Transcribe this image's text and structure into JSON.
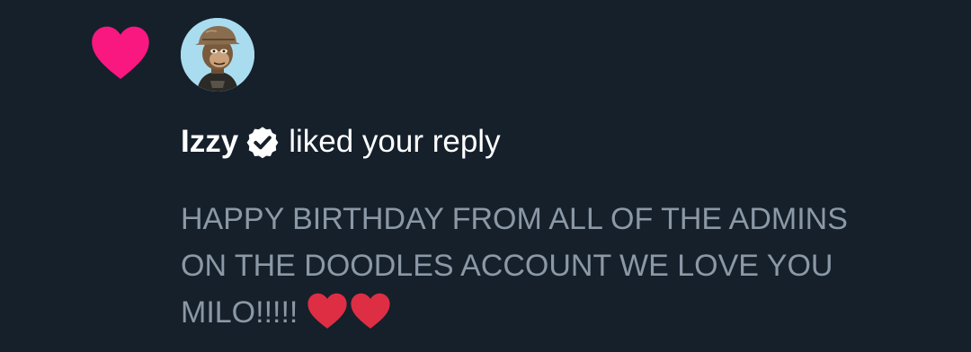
{
  "notification": {
    "type_icon": "heart-icon",
    "avatar_icon": "ape-avatar-icon",
    "username": "Izzy",
    "verified_icon": "verified-badge-icon",
    "action": "liked your reply",
    "reply_lines": [
      "HAPPY BIRTHDAY FROM ALL OF THE ADMINS",
      "ON THE DOODLES ACCOUNT WE LOVE YOU",
      "MILO!!!!!"
    ],
    "reply_emoji": "red-heart-icon",
    "colors": {
      "background": "#15202b",
      "like_heart": "#f91880",
      "text_primary": "#ffffff",
      "text_secondary": "#8b98a5",
      "emoji_heart": "#dd2e44"
    }
  }
}
